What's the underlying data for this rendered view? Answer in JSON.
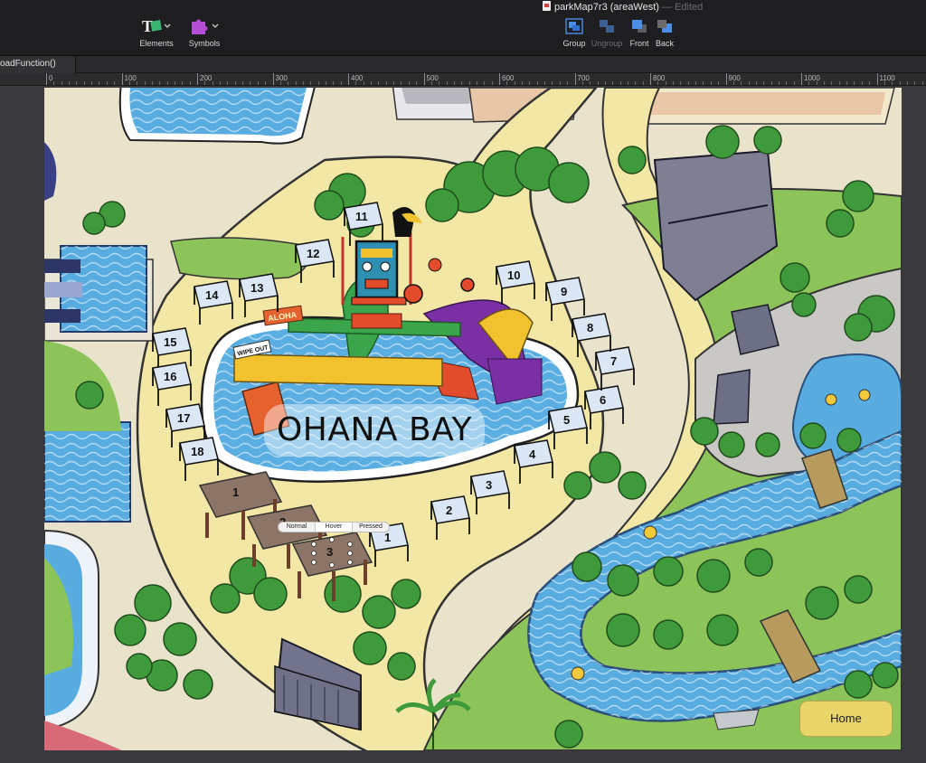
{
  "toolbar": {
    "elements_label": "Elements",
    "symbols_label": "Symbols",
    "group_label": "Group",
    "ungroup_label": "Ungroup",
    "front_label": "Front",
    "back_label": "Back"
  },
  "document": {
    "title": "parkMap7r3 (areaWest)",
    "status": "— Edited"
  },
  "tabs": [
    {
      "label": "oadFunction()"
    }
  ],
  "ruler": {
    "labels": [
      "0",
      "100",
      "200",
      "300",
      "400",
      "500",
      "600",
      "700",
      "800",
      "900",
      "1000",
      "1100"
    ]
  },
  "map": {
    "area_name": "OHANA BAY",
    "cabanas": [
      "1",
      "2",
      "3",
      "4",
      "5",
      "6",
      "7",
      "8",
      "9",
      "10",
      "11",
      "12",
      "13",
      "14",
      "15",
      "16",
      "17",
      "18"
    ],
    "pergolas": [
      "1",
      "2",
      "3"
    ],
    "signs": [
      "ALOHA",
      "WIPE OUT"
    ]
  },
  "button_states": {
    "normal": "Normal",
    "hover": "Hover",
    "pressed": "Pressed"
  },
  "home_button": {
    "label": "Home",
    "color": "#ead56b"
  },
  "colors": {
    "water": "#5fa8dc",
    "grass": "#8cc45a",
    "tree": "#3f9a3c",
    "path": "#f1e6a8",
    "toolbar": "#1e1e20"
  }
}
